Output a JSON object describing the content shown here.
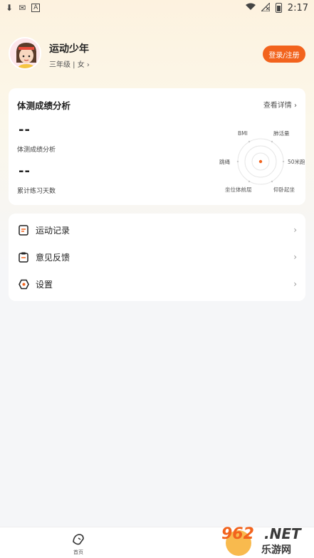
{
  "status_bar": {
    "time": "2:17"
  },
  "profile": {
    "name": "运动少年",
    "info": "三年级 | 女 ›",
    "login_label": "登录/注册"
  },
  "analysis": {
    "title": "体测成绩分析",
    "details_label": "查看详情 ›",
    "score_value": "--",
    "score_label": "体测成绩分析",
    "days_value": "--",
    "days_label": "累计练习天数",
    "radar_labels": [
      "BMI",
      "肺活量",
      "50米跑",
      "仰卧起坐",
      "坐位体前屈",
      "跳绳"
    ]
  },
  "menu": [
    {
      "label": "运动记录",
      "icon": "record-icon"
    },
    {
      "label": "意见反馈",
      "icon": "feedback-icon"
    },
    {
      "label": "设置",
      "icon": "settings-icon"
    }
  ],
  "bottom_nav": {
    "home_label": "首页"
  },
  "watermark": {
    "text": "962.NET",
    "sub": "乐游网"
  },
  "colors": {
    "accent": "#f2631d",
    "background": "#f5f6f8"
  }
}
